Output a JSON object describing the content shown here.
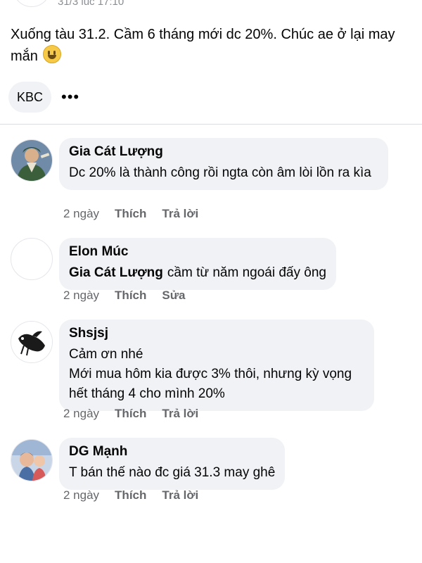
{
  "post": {
    "time": "31/3 lúc 17:10",
    "text": "Xuống tàu 31.2. Cầm 6 tháng mới dc 20%. Chúc ae ở lại may mắn",
    "emoji": "grinning-face-emoji",
    "tag": "KBC",
    "more": "•••"
  },
  "comments": [
    {
      "author": "Gia Cát Lượng",
      "text": "Dc 20% là thành công rồi ngta còn âm lòi lồn ra kìa",
      "time": "2 ngày",
      "like": "Thích",
      "reply": "Trả lời"
    },
    {
      "author": "Elon Múc",
      "mention": "Gia Cát Lượng",
      "text": "cầm từ năm ngoái đấy ông",
      "time": "2 ngày",
      "like": "Thích",
      "reply": "Sửa"
    },
    {
      "author": "Shsjsj",
      "line1": "Cảm ơn nhé",
      "text": "Mới mua hôm kia được 3% thôi, nhưng kỳ vọng hết tháng 4 cho mình 20%",
      "time": "2 ngày",
      "like": "Thích",
      "reply": "Trả lời"
    },
    {
      "author": "DG Mạnh",
      "text": "T bán thế nào đc giá 31.3 may ghê",
      "time": "2 ngày",
      "like": "Thích",
      "reply": "Trả lời"
    }
  ],
  "colors": {
    "bubble": "#f0f2f5",
    "meta": "#65676b",
    "text": "#050505"
  }
}
